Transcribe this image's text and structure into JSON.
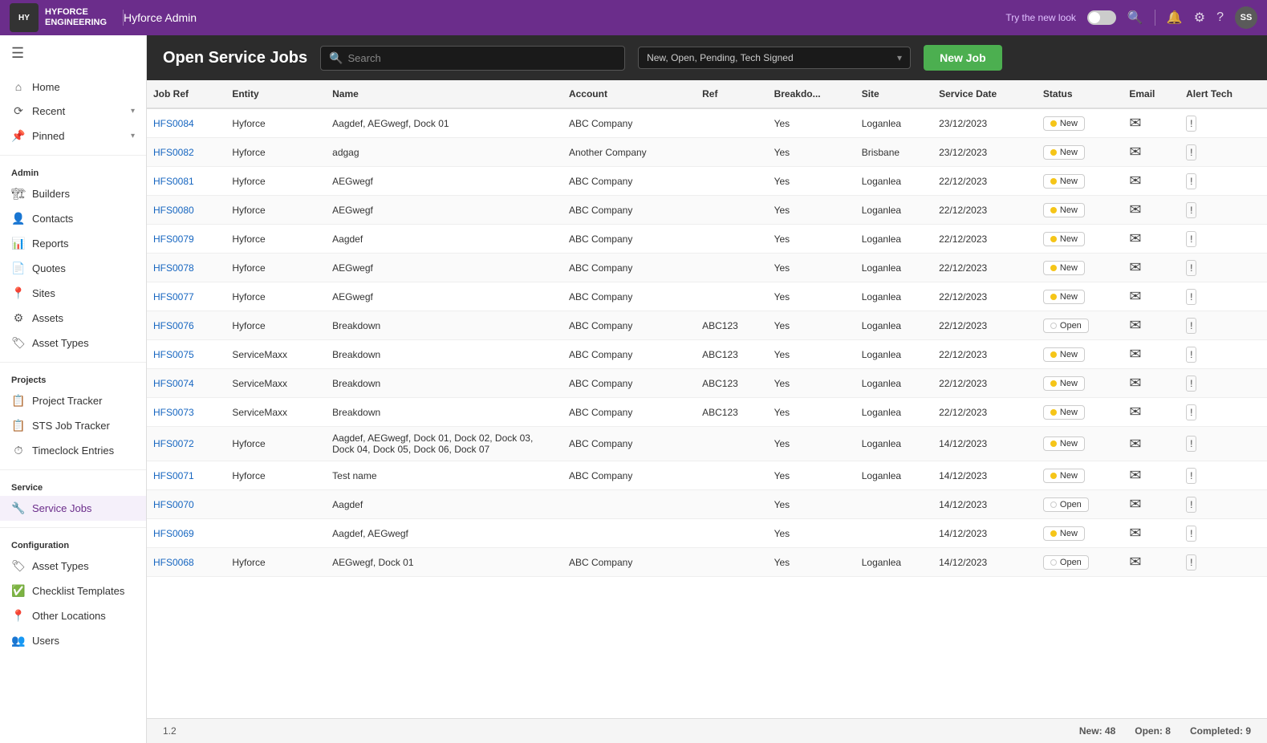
{
  "topbar": {
    "logo_text": "HYFORCE\nENGINEERING",
    "title": "Hyforce Admin",
    "try_label": "Try the new look",
    "avatar_initials": "SS"
  },
  "sidebar": {
    "hamburger": "☰",
    "nav_items": [
      {
        "id": "home",
        "icon": "⌂",
        "label": "Home"
      },
      {
        "id": "recent",
        "icon": "⟳",
        "label": "Recent",
        "has_chevron": true
      },
      {
        "id": "pinned",
        "icon": "📌",
        "label": "Pinned",
        "has_chevron": true
      }
    ],
    "admin_section": "Admin",
    "admin_items": [
      {
        "id": "builders",
        "icon": "🏗",
        "label": "Builders"
      },
      {
        "id": "contacts",
        "icon": "👤",
        "label": "Contacts"
      },
      {
        "id": "reports",
        "icon": "📊",
        "label": "Reports"
      },
      {
        "id": "quotes",
        "icon": "📄",
        "label": "Quotes"
      },
      {
        "id": "sites",
        "icon": "📍",
        "label": "Sites"
      },
      {
        "id": "assets",
        "icon": "⚙",
        "label": "Assets"
      },
      {
        "id": "asset-types",
        "icon": "🏷",
        "label": "Asset Types"
      }
    ],
    "projects_section": "Projects",
    "projects_items": [
      {
        "id": "project-tracker",
        "icon": "📋",
        "label": "Project Tracker"
      },
      {
        "id": "sts-job-tracker",
        "icon": "📋",
        "label": "STS Job Tracker"
      },
      {
        "id": "timeclock",
        "icon": "⏱",
        "label": "Timeclock Entries"
      }
    ],
    "service_section": "Service",
    "service_items": [
      {
        "id": "service-jobs",
        "icon": "🔧",
        "label": "Service Jobs",
        "active": true
      }
    ],
    "config_section": "Configuration",
    "config_items": [
      {
        "id": "config-asset-types",
        "icon": "🏷",
        "label": "Asset Types"
      },
      {
        "id": "checklist-templates",
        "icon": "✅",
        "label": "Checklist Templates"
      },
      {
        "id": "other-locations",
        "icon": "📍",
        "label": "Other Locations"
      },
      {
        "id": "users",
        "icon": "👥",
        "label": "Users"
      }
    ]
  },
  "header": {
    "title": "Open Service Jobs",
    "search_placeholder": "Search",
    "filter_value": "New, Open, Pending, Tech Signed",
    "new_job_label": "New Job"
  },
  "table": {
    "columns": [
      "Job Ref",
      "Entity",
      "Name",
      "Account",
      "Ref",
      "Breakdo...",
      "Site",
      "Service Date",
      "Status",
      "Email",
      "Alert Tech"
    ],
    "rows": [
      {
        "job_ref": "HFS0084",
        "entity": "Hyforce",
        "name": "Aagdef, AEGwegf, Dock 01",
        "account": "ABC Company",
        "ref": "",
        "breakdown": "Yes",
        "site": "Loganlea",
        "service_date": "23/12/2023",
        "status": "New",
        "status_type": "new"
      },
      {
        "job_ref": "HFS0082",
        "entity": "Hyforce",
        "name": "adgag",
        "account": "Another Company",
        "ref": "",
        "breakdown": "Yes",
        "site": "Brisbane",
        "service_date": "23/12/2023",
        "status": "New",
        "status_type": "new"
      },
      {
        "job_ref": "HFS0081",
        "entity": "Hyforce",
        "name": "AEGwegf",
        "account": "ABC Company",
        "ref": "",
        "breakdown": "Yes",
        "site": "Loganlea",
        "service_date": "22/12/2023",
        "status": "New",
        "status_type": "new"
      },
      {
        "job_ref": "HFS0080",
        "entity": "Hyforce",
        "name": "AEGwegf",
        "account": "ABC Company",
        "ref": "",
        "breakdown": "Yes",
        "site": "Loganlea",
        "service_date": "22/12/2023",
        "status": "New",
        "status_type": "new"
      },
      {
        "job_ref": "HFS0079",
        "entity": "Hyforce",
        "name": "Aagdef",
        "account": "ABC Company",
        "ref": "",
        "breakdown": "Yes",
        "site": "Loganlea",
        "service_date": "22/12/2023",
        "status": "New",
        "status_type": "new"
      },
      {
        "job_ref": "HFS0078",
        "entity": "Hyforce",
        "name": "AEGwegf",
        "account": "ABC Company",
        "ref": "",
        "breakdown": "Yes",
        "site": "Loganlea",
        "service_date": "22/12/2023",
        "status": "New",
        "status_type": "new"
      },
      {
        "job_ref": "HFS0077",
        "entity": "Hyforce",
        "name": "AEGwegf",
        "account": "ABC Company",
        "ref": "",
        "breakdown": "Yes",
        "site": "Loganlea",
        "service_date": "22/12/2023",
        "status": "New",
        "status_type": "new"
      },
      {
        "job_ref": "HFS0076",
        "entity": "Hyforce",
        "name": "Breakdown",
        "account": "ABC Company",
        "ref": "ABC123",
        "breakdown": "Yes",
        "site": "Loganlea",
        "service_date": "22/12/2023",
        "status": "Open",
        "status_type": "open"
      },
      {
        "job_ref": "HFS0075",
        "entity": "ServiceMaxx",
        "name": "Breakdown",
        "account": "ABC Company",
        "ref": "ABC123",
        "breakdown": "Yes",
        "site": "Loganlea",
        "service_date": "22/12/2023",
        "status": "New",
        "status_type": "new"
      },
      {
        "job_ref": "HFS0074",
        "entity": "ServiceMaxx",
        "name": "Breakdown",
        "account": "ABC Company",
        "ref": "ABC123",
        "breakdown": "Yes",
        "site": "Loganlea",
        "service_date": "22/12/2023",
        "status": "New",
        "status_type": "new"
      },
      {
        "job_ref": "HFS0073",
        "entity": "ServiceMaxx",
        "name": "Breakdown",
        "account": "ABC Company",
        "ref": "ABC123",
        "breakdown": "Yes",
        "site": "Loganlea",
        "service_date": "22/12/2023",
        "status": "New",
        "status_type": "new"
      },
      {
        "job_ref": "HFS0072",
        "entity": "Hyforce",
        "name": "Aagdef, AEGwegf, Dock 01, Dock 02, Dock 03, Dock 04, Dock 05, Dock 06, Dock 07",
        "account": "ABC Company",
        "ref": "",
        "breakdown": "Yes",
        "site": "Loganlea",
        "service_date": "14/12/2023",
        "status": "New",
        "status_type": "new"
      },
      {
        "job_ref": "HFS0071",
        "entity": "Hyforce",
        "name": "Test name",
        "account": "ABC Company",
        "ref": "",
        "breakdown": "Yes",
        "site": "Loganlea",
        "service_date": "14/12/2023",
        "status": "New",
        "status_type": "new"
      },
      {
        "job_ref": "HFS0070",
        "entity": "",
        "name": "Aagdef",
        "account": "",
        "ref": "",
        "breakdown": "Yes",
        "site": "",
        "service_date": "14/12/2023",
        "status": "Open",
        "status_type": "open"
      },
      {
        "job_ref": "HFS0069",
        "entity": "",
        "name": "Aagdef, AEGwegf",
        "account": "",
        "ref": "",
        "breakdown": "Yes",
        "site": "",
        "service_date": "14/12/2023",
        "status": "New",
        "status_type": "new"
      },
      {
        "job_ref": "HFS0068",
        "entity": "Hyforce",
        "name": "AEGwegf, Dock 01",
        "account": "ABC Company",
        "ref": "",
        "breakdown": "Yes",
        "site": "Loganlea",
        "service_date": "14/12/2023",
        "status": "Open",
        "status_type": "open"
      }
    ]
  },
  "footer": {
    "version": "1.2",
    "new_label": "New:",
    "new_count": "48",
    "open_label": "Open:",
    "open_count": "8",
    "completed_label": "Completed:",
    "completed_count": "9"
  }
}
